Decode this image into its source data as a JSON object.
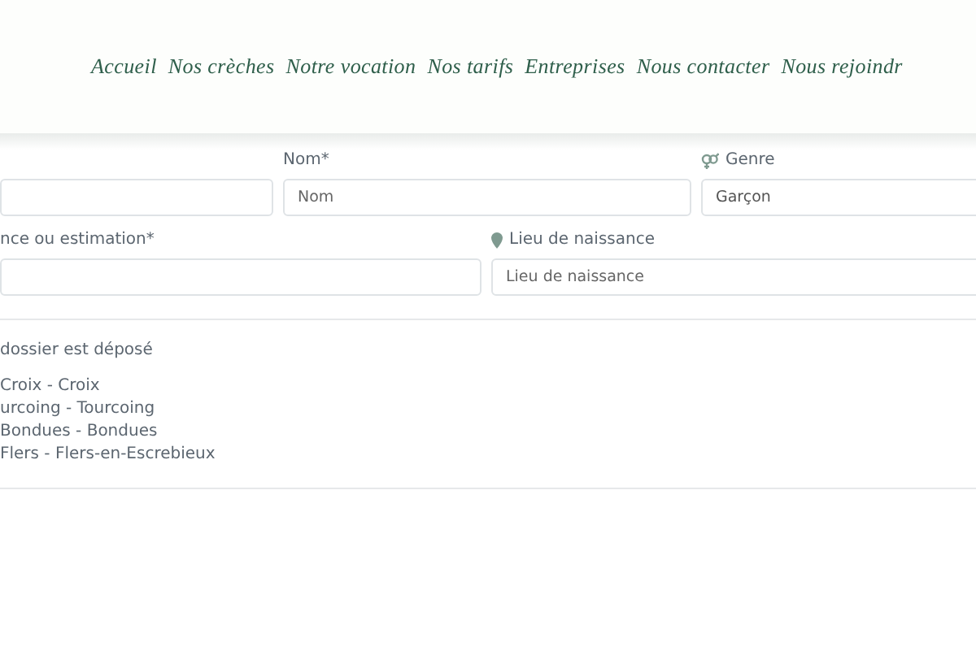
{
  "nav": {
    "items": [
      {
        "label": "Accueil"
      },
      {
        "label": "Nos crèches"
      },
      {
        "label": "Notre vocation"
      },
      {
        "label": "Nos tarifs"
      },
      {
        "label": "Entreprises"
      },
      {
        "label": "Nous contacter"
      },
      {
        "label": "Nous rejoindr"
      }
    ]
  },
  "form": {
    "row_1": [
      {
        "kind": "plain"
      },
      {
        "kind": "plain",
        "label": "Nom*",
        "placeholder": "Nom"
      },
      {
        "kind": "gender",
        "label": "Genre",
        "value": "Garçon"
      }
    ],
    "row_2": [
      {
        "kind": "plain",
        "label": "nce ou estimation*"
      },
      {
        "kind": "place",
        "label": "Lieu de naissance",
        "placeholder": "Lieu de naissance"
      }
    ]
  },
  "section": {
    "title": "dossier est déposé",
    "items": [
      "Croix - Croix",
      "urcoing - Tourcoing",
      "Bondues - Bondues",
      "Flers - Flers-en-Escrebieux"
    ]
  }
}
